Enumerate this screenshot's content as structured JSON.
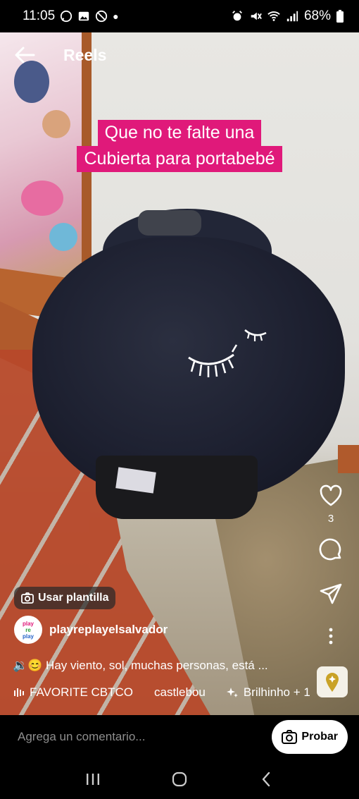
{
  "status": {
    "time": "11:05",
    "battery": "68%"
  },
  "nav": {
    "title": "Reels"
  },
  "overlay": {
    "line1": "Que no te falte una",
    "line2": "Cubierta para portabebé"
  },
  "actions": {
    "likes": "3"
  },
  "template": {
    "label": "Usar plantilla"
  },
  "author": {
    "username": "playreplayelsalvador",
    "avatar_text": [
      "play",
      "re",
      "play"
    ]
  },
  "caption": {
    "text": "🔉😊 Hay viento, sol, muchas personas, está ..."
  },
  "audio": {
    "track1": "FAVORITE CBTCO",
    "track2": "castlebou",
    "effect": "Brilhinho + 1"
  },
  "comment": {
    "placeholder": "Agrega un comentario...",
    "try_label": "Probar"
  },
  "colors": {
    "overlay_bg": "#e0197a",
    "accent_pin": "#c9a227"
  },
  "icons": [
    "back-arrow-icon",
    "heart-icon",
    "comment-icon",
    "share-icon",
    "more-icon",
    "camera-icon",
    "map-pin-icon",
    "sparkle-icon",
    "audio-bars-icon"
  ]
}
